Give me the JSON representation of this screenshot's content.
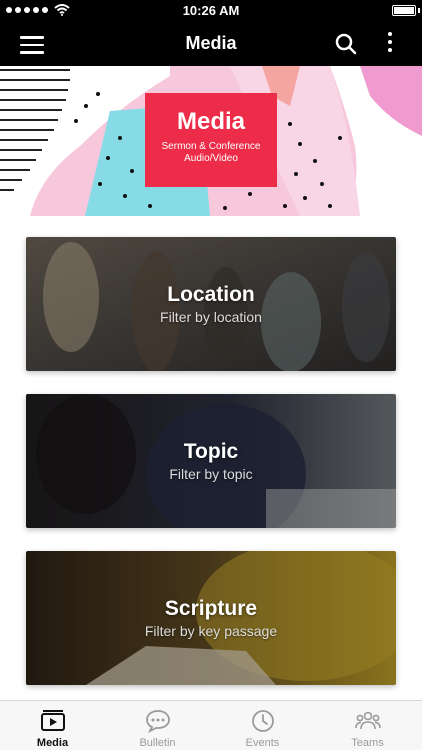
{
  "status_bar": {
    "time": "10:26 AM"
  },
  "nav": {
    "title": "Media"
  },
  "hero": {
    "title": "Media",
    "subtitle_line1": "Sermon & Conference",
    "subtitle_line2": "Audio/Video"
  },
  "cards": [
    {
      "title": "Location",
      "subtitle": "Filter by location"
    },
    {
      "title": "Topic",
      "subtitle": "Filter by topic"
    },
    {
      "title": "Scripture",
      "subtitle": "Filter by key passage"
    }
  ],
  "tabs": [
    {
      "label": "Media",
      "icon": "media-icon",
      "active": true
    },
    {
      "label": "Bulletin",
      "icon": "chat-bubble-icon",
      "active": false
    },
    {
      "label": "Events",
      "icon": "clock-icon",
      "active": false
    },
    {
      "label": "Teams",
      "icon": "people-icon",
      "active": false
    }
  ],
  "colors": {
    "accent": "#ec2c48",
    "nav_background": "#000000",
    "tab_active": "#111111",
    "tab_inactive": "#9a9a9a"
  }
}
